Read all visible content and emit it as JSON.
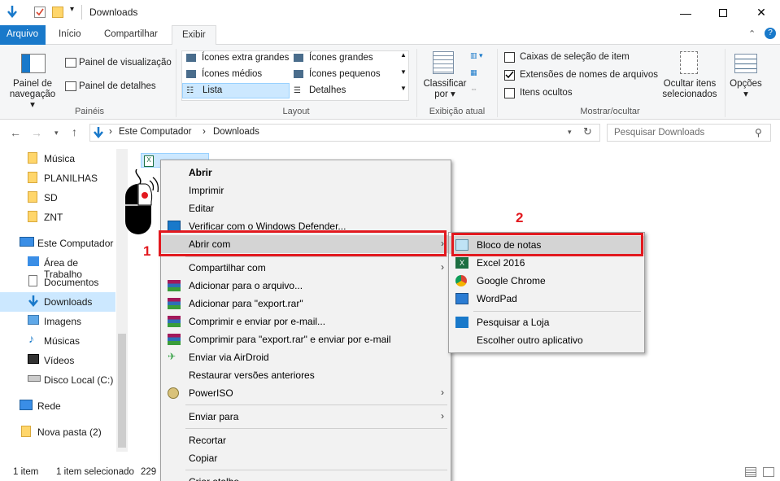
{
  "window": {
    "title": "Downloads"
  },
  "ribbon_tabs": [
    "Arquivo",
    "Início",
    "Compartilhar",
    "Exibir"
  ],
  "ribbon": {
    "panes": {
      "nav_pane": "Painel de",
      "nav_pane2": "navegação",
      "preview": "Painel de visualização",
      "details": "Painel de detalhes",
      "label": "Painéis"
    },
    "layout": {
      "items": [
        "Ícones extra grandes",
        "Ícones grandes",
        "Ícones médios",
        "Ícones pequenos",
        "Lista",
        "Detalhes"
      ],
      "label": "Layout"
    },
    "current_view": {
      "sort": "Classificar",
      "sort2": "por",
      "label": "Exibição atual"
    },
    "show_hide": {
      "item_checkboxes": "Caixas de seleção de item",
      "extensions": "Extensões de nomes de arquivos",
      "hidden": "Itens ocultos",
      "hide_selected": "Ocultar itens",
      "hide_selected2": "selecionados",
      "label": "Mostrar/ocultar"
    },
    "options": "Opções"
  },
  "address": {
    "crumbs": [
      "Este Computador",
      "Downloads"
    ],
    "search_placeholder": "Pesquisar Downloads"
  },
  "nav": [
    "Música",
    "PLANILHAS",
    "SD",
    "ZNT",
    "Este Computador",
    "Área de Trabalho",
    "Documentos",
    "Downloads",
    "Imagens",
    "Músicas",
    "Vídeos",
    "Disco Local (C:)",
    "Rede",
    "Nova pasta (2)"
  ],
  "status": {
    "count": "1 item",
    "selected": "1 item selecionado",
    "size": "229"
  },
  "context_menu": [
    "Abrir",
    "Imprimir",
    "Editar",
    "Verificar com o Windows Defender...",
    "Abrir com",
    "Compartilhar com",
    "Adicionar para o arquivo...",
    "Adicionar para \"export.rar\"",
    "Comprimir e enviar por e-mail...",
    "Comprimir para \"export.rar\" e enviar por e-mail",
    "Enviar via AirDroid",
    "Restaurar versões anteriores",
    "PowerISO",
    "Enviar para",
    "Recortar",
    "Copiar",
    "Criar atalho"
  ],
  "submenu": [
    "Bloco de notas",
    "Excel 2016",
    "Google Chrome",
    "WordPad",
    "Pesquisar a Loja",
    "Escolher outro aplicativo"
  ],
  "markers": {
    "one": "1",
    "two": "2"
  },
  "colors": {
    "accent": "#1979ca",
    "highlight_red": "#e2191f",
    "selection": "#cce8ff"
  }
}
